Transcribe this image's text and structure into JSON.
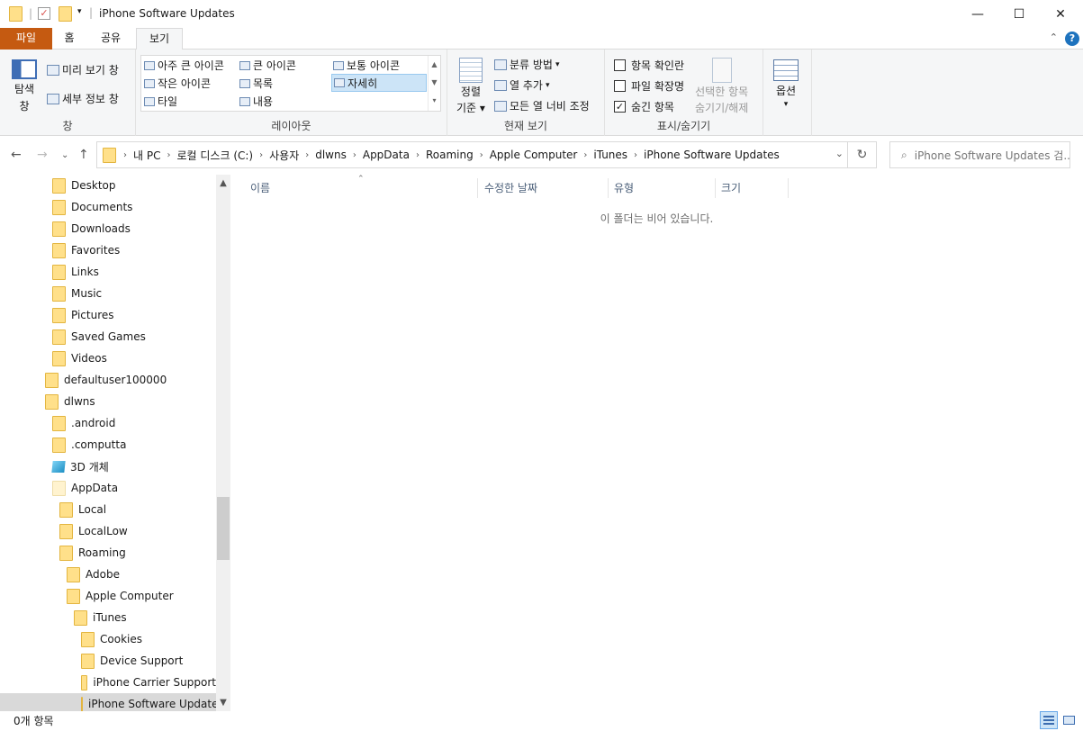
{
  "window": {
    "title": "iPhone Software Updates",
    "minimize": "—",
    "maximize": "☐",
    "close": "✕"
  },
  "tabs": {
    "file": "파일",
    "home": "홈",
    "share": "공유",
    "view": "보기"
  },
  "ribbon": {
    "pane_group": {
      "nav_pane": "탐색",
      "nav_pane2": "창",
      "preview": "미리 보기 창",
      "details": "세부 정보 창",
      "label": "창"
    },
    "layout_group": {
      "extra_large": "아주 큰 아이콘",
      "large": "큰 아이콘",
      "medium": "보통 아이콘",
      "small": "작은 아이콘",
      "list": "목록",
      "details": "자세히",
      "tiles": "타일",
      "content": "내용",
      "label": "레이아웃"
    },
    "current_view_group": {
      "sort_by": "정렬",
      "sort_by2": "기준",
      "group_by": "분류 방법",
      "add_columns": "열 추가",
      "size_all_columns": "모든 열 너비 조정",
      "label": "현재 보기"
    },
    "show_hide_group": {
      "item_checkboxes": "항목 확인란",
      "file_extensions": "파일 확장명",
      "hidden_items": "숨긴 항목",
      "hide_selected": "선택한 항목",
      "hide_selected2": "숨기기/해제",
      "label": "표시/숨기기"
    },
    "options": "옵션"
  },
  "address": {
    "crumbs": [
      "내 PC",
      "로컬 디스크 (C:)",
      "사용자",
      "dlwns",
      "AppData",
      "Roaming",
      "Apple Computer",
      "iTunes",
      "iPhone Software Updates"
    ],
    "search_placeholder": "iPhone Software Updates 검..."
  },
  "tree": {
    "items": [
      "Desktop",
      "Documents",
      "Downloads",
      "Favorites",
      "Links",
      "Music",
      "Pictures",
      "Saved Games",
      "Videos",
      "defaultuser100000",
      "dlwns",
      ".android",
      ".computta",
      "3D 개체",
      "AppData",
      "Local",
      "LocalLow",
      "Roaming",
      "Adobe",
      "Apple Computer",
      "iTunes",
      "Cookies",
      "Device Support",
      "iPhone Carrier Support",
      "iPhone Software Updates"
    ]
  },
  "columns": {
    "name": "이름",
    "date": "수정한 날짜",
    "type": "유형",
    "size": "크기"
  },
  "content": {
    "empty_message": "이 폴더는 비어 있습니다."
  },
  "status": {
    "count": "0개 항목"
  }
}
